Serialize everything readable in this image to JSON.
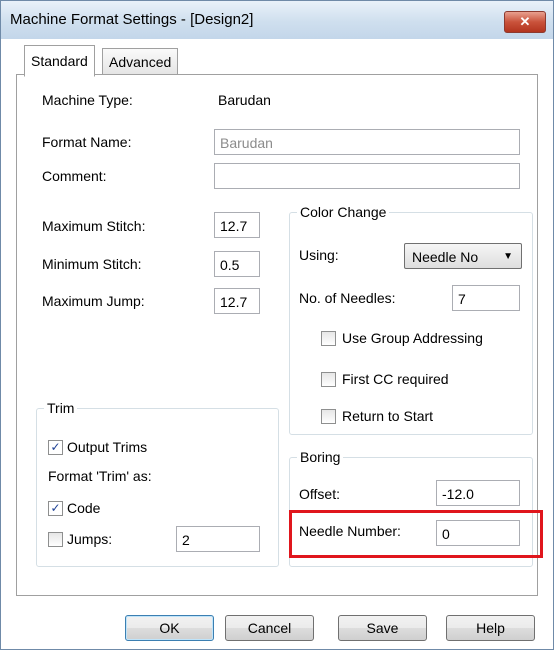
{
  "window": {
    "title": "Machine Format Settings - [Design2]",
    "close_glyph": "✕"
  },
  "tabs": [
    {
      "label": "Standard"
    },
    {
      "label": "Advanced"
    }
  ],
  "general": {
    "machine_type_label": "Machine Type:",
    "machine_type_value": "Barudan",
    "format_name_label": "Format Name:",
    "format_name_value": "Barudan",
    "comment_label": "Comment:",
    "comment_value": ""
  },
  "stitch": {
    "max_stitch_label": "Maximum Stitch:",
    "max_stitch_value": "12.7",
    "min_stitch_label": "Minimum Stitch:",
    "min_stitch_value": "0.5",
    "max_jump_label": "Maximum Jump:",
    "max_jump_value": "12.7"
  },
  "color_change": {
    "legend": "Color Change",
    "using_label": "Using:",
    "using_value": "Needle No",
    "needles_label": "No. of Needles:",
    "needles_value": "7",
    "group_addressing_label": "Use Group Addressing",
    "first_cc_label": "First CC required",
    "return_start_label": "Return to Start"
  },
  "trim": {
    "legend": "Trim",
    "output_trims_label": "Output Trims",
    "format_as_label": "Format 'Trim' as:",
    "code_label": "Code",
    "jumps_label": "Jumps:",
    "jumps_value": "2"
  },
  "boring": {
    "legend": "Boring",
    "offset_label": "Offset:",
    "offset_value": "-12.0",
    "needle_number_label": "Needle Number:",
    "needle_number_value": "0"
  },
  "buttons": {
    "ok": "OK",
    "cancel": "Cancel",
    "save": "Save",
    "help": "Help"
  },
  "check_glyph": "✓",
  "colors": {
    "highlight": "#e0161d",
    "title_bar": "#cfdfee"
  }
}
